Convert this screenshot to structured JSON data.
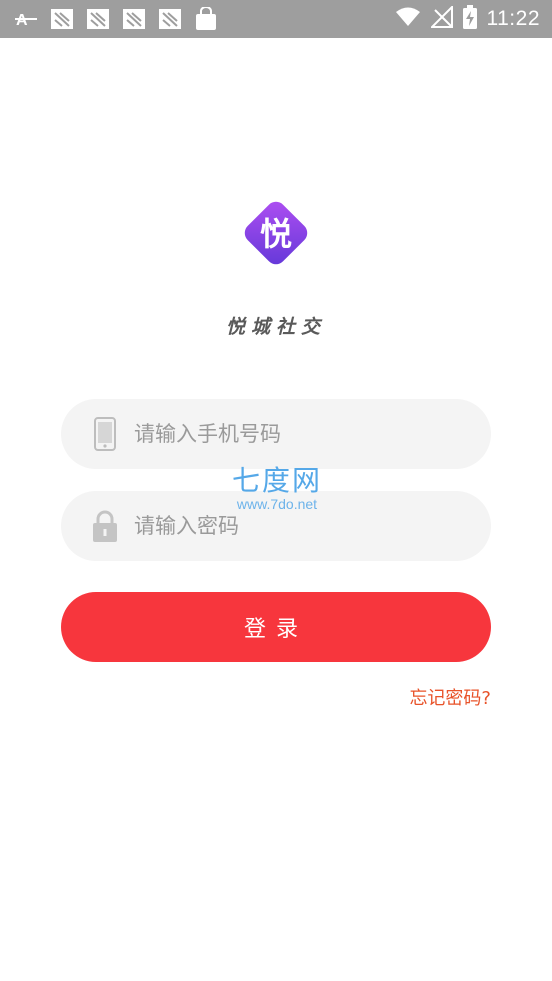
{
  "status_bar": {
    "time": "11:22",
    "left_icons": [
      "font-a-icon",
      "notification-icon",
      "notification-icon",
      "notification-icon",
      "notification-icon",
      "shopping-bag-icon"
    ],
    "right_icons": [
      "wifi-icon",
      "no-signal-icon",
      "battery-charging-icon"
    ]
  },
  "app": {
    "logo_char": "悦",
    "name": "悦城社交",
    "logo_colors": [
      "#a24bf0",
      "#6a3de0"
    ]
  },
  "login_form": {
    "phone_placeholder": "请输入手机号码",
    "password_placeholder": "请输入密码",
    "login_label": "登录",
    "forgot_label": "忘记密码?"
  },
  "watermark": {
    "title": "七度网",
    "url": "www.7do.net"
  },
  "colors": {
    "accent": "#f7363d",
    "link": "#e8532a",
    "status_bar": "#9e9e9e"
  }
}
